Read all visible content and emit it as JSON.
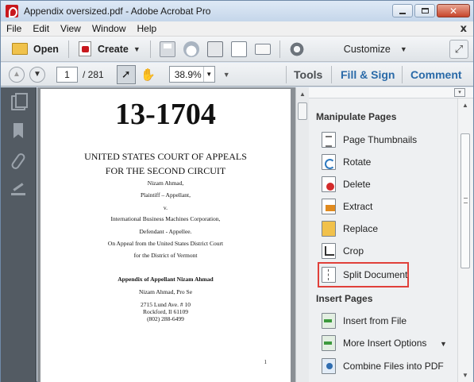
{
  "window": {
    "title": "Appendix oversized.pdf - Adobe Acrobat Pro"
  },
  "menu": {
    "items": [
      "File",
      "Edit",
      "View",
      "Window",
      "Help"
    ],
    "close_glyph": "x"
  },
  "toolbar": {
    "open_label": "Open",
    "create_label": "Create",
    "customize_label": "Customize"
  },
  "navigation": {
    "current_page": "1",
    "page_total": "/ 281",
    "zoom": "38.9%"
  },
  "panes": {
    "tools": "Tools",
    "fill_sign": "Fill & Sign",
    "comment": "Comment"
  },
  "document": {
    "case_number": "13-1704",
    "court_line1": "UNITED STATES COURT OF APPEALS",
    "court_line2": "FOR THE SECOND CIRCUIT",
    "party1": "Nizam Ahmad,",
    "party1_role": "Plaintiff – Appellant,",
    "versus": "v.",
    "party2": "International Business Machines Corporation,",
    "party2_role": "Defendant - Appellee.",
    "appeal_line1": "On Appeal from the United States District Court",
    "appeal_line2": "for the District of Vermont",
    "appendix_title": "Appendix of Appellant Nizam Ahmad",
    "author": "Nizam Ahmad, Pro Se",
    "address1": "2715 Lund Ave. # 10",
    "address2": "Rockford, Il 61109",
    "phone": "(802) 288-6499",
    "page_number": "1"
  },
  "tools_panel": {
    "manipulate_heading": "Manipulate Pages",
    "manipulate_items": [
      "Page Thumbnails",
      "Rotate",
      "Delete",
      "Extract",
      "Replace",
      "Crop",
      "Split Document"
    ],
    "insert_heading": "Insert Pages",
    "insert_items": [
      "Insert from File",
      "More Insert Options",
      "Combine Files into PDF"
    ],
    "highlighted_item": "Split Document",
    "highlight_color": "#e0403a"
  }
}
